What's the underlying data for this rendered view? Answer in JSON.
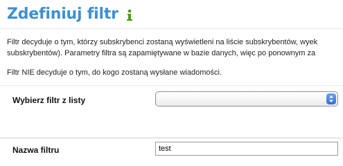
{
  "header": {
    "title": "Zdefiniuj filtr",
    "info_icon": "info-icon"
  },
  "description": {
    "line1": "Filtr decyduje o tym, którzy subskrybenci zostaną wyświetleni na liście subskrybentów, wyek",
    "line2": "subskrybentów). Parametry filtra są zapamiętywane w bazie danych, więc po ponownym za",
    "line3": "Filtr NIE decyduje o tym, do kogo zostaną wysłane wiadomości."
  },
  "form": {
    "select_filter": {
      "label": "Wybierz filtr z listy",
      "selected_value": ""
    },
    "filter_name": {
      "label": "Nazwa filtru",
      "value": "test"
    }
  },
  "colors": {
    "title": "#3f8fd2",
    "icon": "#4f9a1c",
    "select_stepper": "#2f6ed8"
  }
}
